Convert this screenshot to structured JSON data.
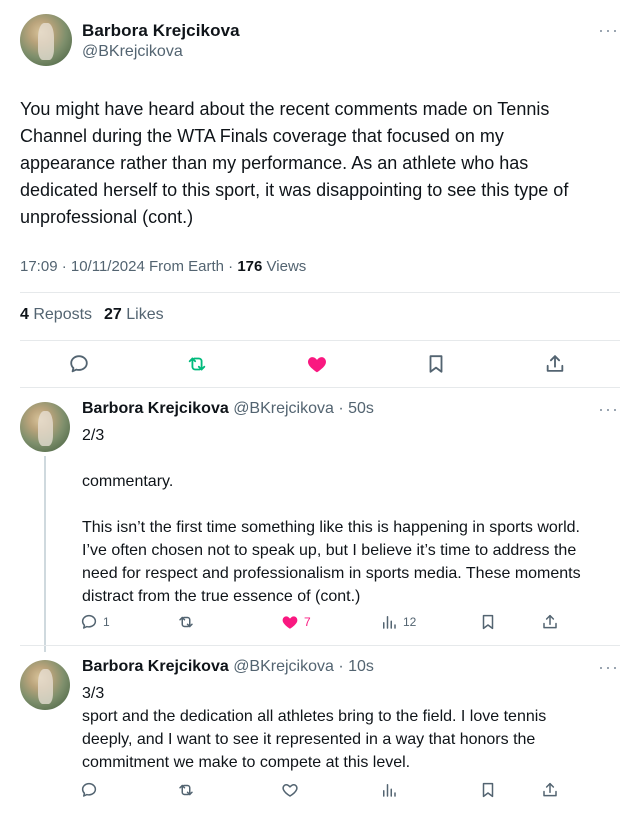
{
  "main_tweet": {
    "author_name": "Barbora Krejcikova",
    "author_handle": "@BKrejcikova",
    "text": "You might have heard about the recent comments made on Tennis\nChannel during the WTA Finals coverage that focused on my\nappearance rather than my performance. As an athlete who has\ndedicated herself to this sport, it was disappointing to see this type of\nunprofessional (cont.)",
    "meta_time": "17:09 · 10/11/2024 From Earth · ",
    "views_count": "176",
    "views_label": " Views",
    "reposts_count": "4",
    "reposts_label": " Reposts",
    "likes_count": "27",
    "likes_label": " Likes",
    "more_label": "···",
    "accent_repost": "#00ba7c",
    "accent_like": "#f91880"
  },
  "replies": [
    {
      "author_name": "Barbora Krejcikova",
      "author_handle": "@BKrejcikova · 50s",
      "text": "2/3\n\ncommentary.\n\nThis isn’t the first time something like this is happening in sports world.\nI’ve often chosen not to speak up, but I believe it’s time to address the\nneed for respect and professionalism in sports media. These moments\ndistract from the true essence of (cont.)",
      "reply_count": "1",
      "like_count": "7",
      "views_count": "12",
      "more_label": "···"
    },
    {
      "author_name": "Barbora Krejcikova",
      "author_handle": "@BKrejcikova · 10s",
      "text": "3/3\nsport and the dedication all athletes bring to the field. I love tennis\ndeeply, and I want to see it represented in a way that honors the\ncommitment we make to compete at this level.",
      "more_label": "···"
    }
  ]
}
